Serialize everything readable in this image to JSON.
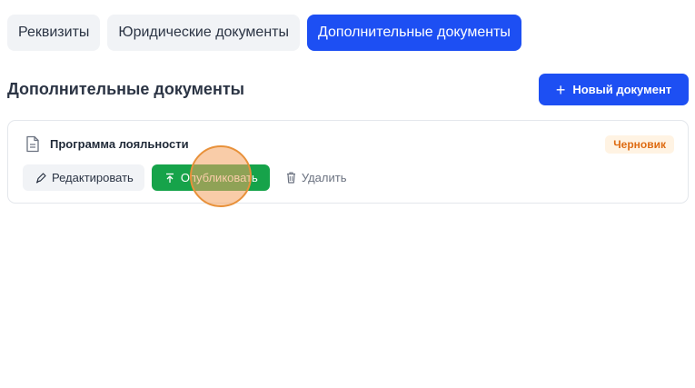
{
  "tabs": [
    {
      "label": "Реквизиты",
      "active": false
    },
    {
      "label": "Юридические документы",
      "active": false
    },
    {
      "label": "Дополнительные документы",
      "active": true
    }
  ],
  "section": {
    "title": "Дополнительные документы",
    "new_button_label": "Новый документ",
    "new_button_icon": "plus-icon"
  },
  "document": {
    "icon": "document-icon",
    "title": "Программа лояльности",
    "status": "Черновик",
    "actions": {
      "edit_label": "Редактировать",
      "edit_icon": "pencil-icon",
      "publish_label": "Опубликовать",
      "publish_icon": "upload-icon",
      "delete_label": "Удалить",
      "delete_icon": "trash-icon"
    }
  },
  "colors": {
    "accent": "#1d4ff3",
    "publish": "#16a34a",
    "draft_text": "#de6b12",
    "draft_bg": "#fff3e3",
    "click_marker": "#f4a261"
  }
}
